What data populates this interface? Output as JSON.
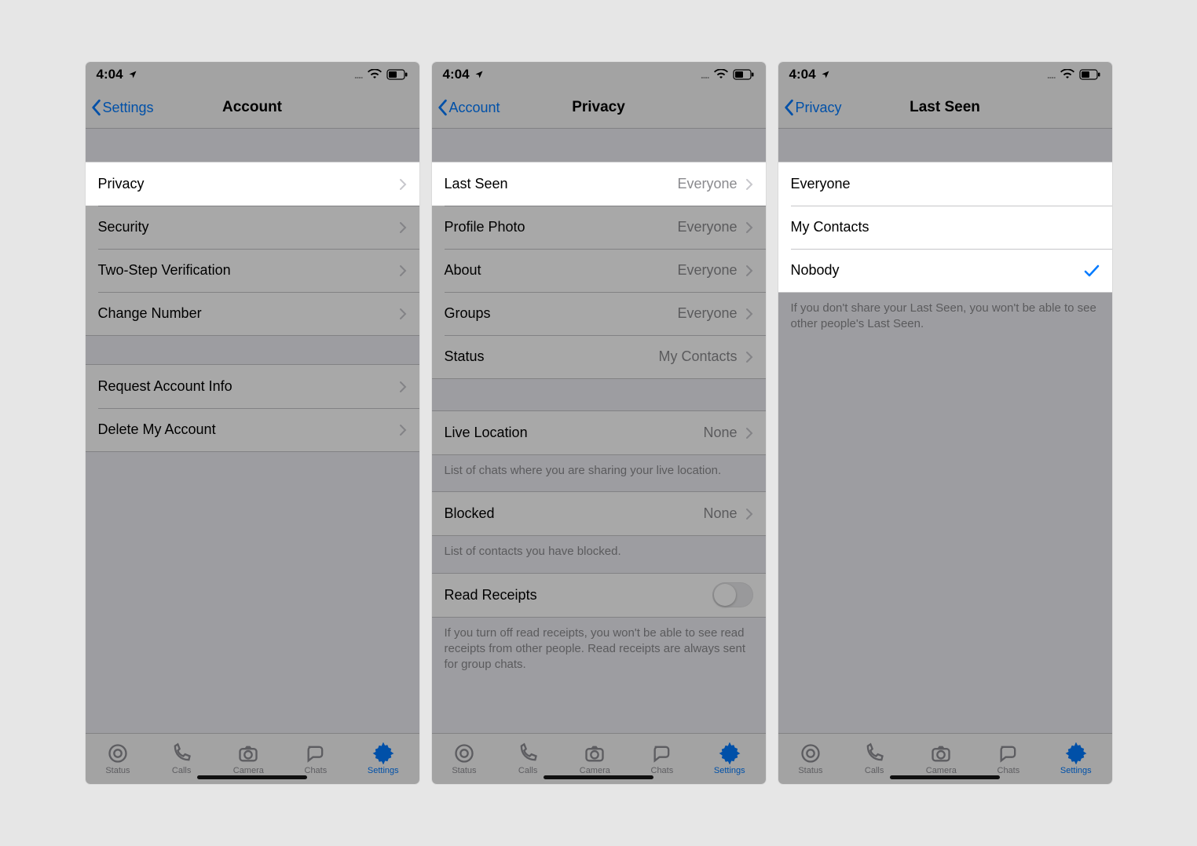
{
  "status": {
    "time": "4:04",
    "signal_dots": "....",
    "location_icon": "location-arrow"
  },
  "tabs": [
    {
      "label": "Status"
    },
    {
      "label": "Calls"
    },
    {
      "label": "Camera"
    },
    {
      "label": "Chats"
    },
    {
      "label": "Settings"
    }
  ],
  "active_tab_index": 4,
  "screen1": {
    "back": "Settings",
    "title": "Account",
    "group1": [
      {
        "label": "Privacy",
        "highlight": true
      },
      {
        "label": "Security"
      },
      {
        "label": "Two-Step Verification"
      },
      {
        "label": "Change Number"
      }
    ],
    "group2": [
      {
        "label": "Request Account Info"
      },
      {
        "label": "Delete My Account"
      }
    ]
  },
  "screen2": {
    "back": "Account",
    "title": "Privacy",
    "group1": [
      {
        "label": "Last Seen",
        "value": "Everyone",
        "highlight": true
      },
      {
        "label": "Profile Photo",
        "value": "Everyone"
      },
      {
        "label": "About",
        "value": "Everyone"
      },
      {
        "label": "Groups",
        "value": "Everyone"
      },
      {
        "label": "Status",
        "value": "My Contacts"
      }
    ],
    "group2": [
      {
        "label": "Live Location",
        "value": "None"
      }
    ],
    "footer2": "List of chats where you are sharing your live location.",
    "group3": [
      {
        "label": "Blocked",
        "value": "None"
      }
    ],
    "footer3": "List of contacts you have blocked.",
    "group4": [
      {
        "label": "Read Receipts",
        "toggle": false
      }
    ],
    "footer4": "If you turn off read receipts, you won't be able to see read receipts from other people. Read receipts are always sent for group chats."
  },
  "screen3": {
    "back": "Privacy",
    "title": "Last Seen",
    "options": [
      {
        "label": "Everyone"
      },
      {
        "label": "My Contacts"
      },
      {
        "label": "Nobody",
        "checked": true
      }
    ],
    "footer": "If you don't share your Last Seen, you won't be able to see other people's Last Seen."
  }
}
